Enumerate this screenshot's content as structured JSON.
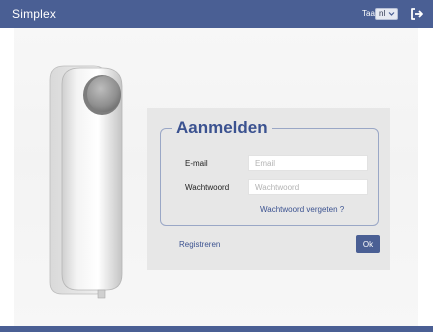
{
  "header": {
    "app_title": "Simplex",
    "language_label": "Taal",
    "language_selected": "nl"
  },
  "login": {
    "heading": "Aanmelden",
    "email_label": "E-mail",
    "email_placeholder": "Email",
    "email_value": "",
    "password_label": "Wachtwoord",
    "password_placeholder": "Wachtwoord",
    "password_value": "",
    "forgot_password_link": "Wachtwoord vergeten ?",
    "register_link": "Registreren",
    "submit_label": "Ok"
  },
  "icons": {
    "logout": "logout-icon",
    "language_dropdown": "chevron-down-icon"
  },
  "colors": {
    "brand": "#4a5f94",
    "heading": "#3b5290",
    "panel": "#e7e7e7",
    "stage": "#f5f5f5"
  }
}
